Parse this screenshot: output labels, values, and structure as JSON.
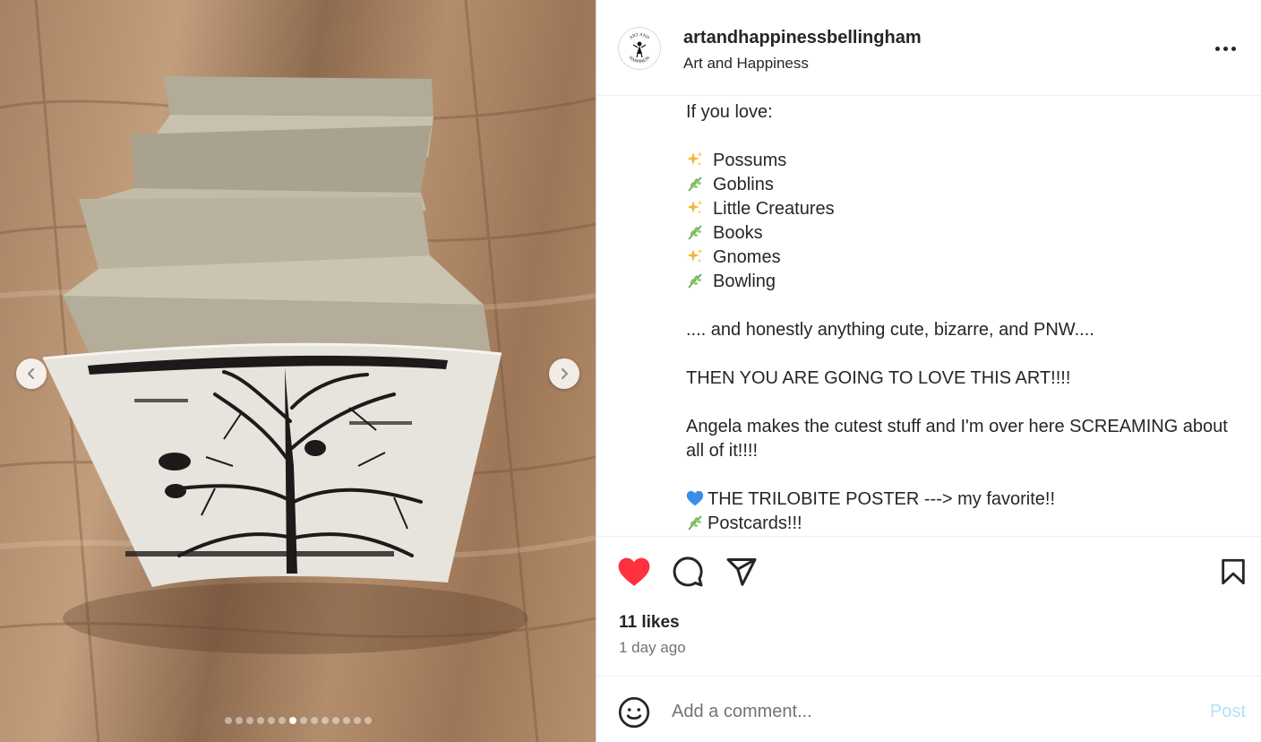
{
  "post": {
    "username": "artandhappinessbellingham",
    "location": "Art and Happiness",
    "avatar_text_top": "ART AND",
    "avatar_text_bottom": "HAPPINESS"
  },
  "carousel": {
    "slide_count": 14,
    "active_index": 6,
    "prev_icon": "chevron-left-icon",
    "next_icon": "chevron-right-icon"
  },
  "caption": {
    "intro": "If you love:",
    "list": [
      {
        "icon": "sparkles-icon",
        "text": "Possums"
      },
      {
        "icon": "herb-icon",
        "text": "Goblins"
      },
      {
        "icon": "sparkles-icon",
        "text": "Little Creatures"
      },
      {
        "icon": "herb-icon",
        "text": "Books"
      },
      {
        "icon": "sparkles-icon",
        "text": "Gnomes"
      },
      {
        "icon": "herb-icon",
        "text": "Bowling"
      }
    ],
    "line_1": ".... and honestly anything cute, bizarre, and PNW....",
    "line_2": "THEN YOU ARE GOING TO LOVE THIS ART!!!!",
    "line_3": "Angela makes the cutest stuff and I'm over here SCREAMING about all of it!!!!",
    "favorites": [
      {
        "icon": "blue-heart-icon",
        "text": "THE TRILOBITE POSTER ---> my favorite!!"
      },
      {
        "icon": "herb-icon",
        "text": "Postcards!!!"
      }
    ]
  },
  "actions": {
    "liked": true,
    "like_color": "#ff3040"
  },
  "stats": {
    "likes": "11 likes",
    "time": "1 day ago"
  },
  "comment": {
    "placeholder": "Add a comment...",
    "post_label": "Post",
    "post_color": "#b2dffc"
  }
}
